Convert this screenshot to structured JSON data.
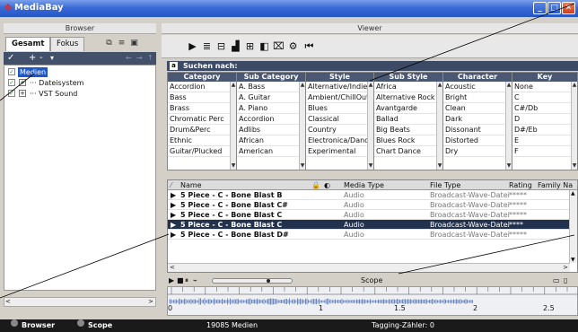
{
  "window": {
    "title": "MediaBay"
  },
  "browser": {
    "header": "Browser",
    "tabs": [
      "Gesamt",
      "Fokus"
    ],
    "toolbar": {
      "add": "+",
      "remove": "-",
      "menu": "▾",
      "back": "←",
      "forward": "→",
      "up": "↑"
    },
    "tree": [
      {
        "label": "Medien",
        "level": 0,
        "selected": true
      },
      {
        "label": "Dateisystem",
        "level": 1
      },
      {
        "label": "VST Sound",
        "level": 1
      }
    ]
  },
  "viewer": {
    "header": "Viewer",
    "search_label": "Suchen nach:",
    "filters": [
      {
        "header": "Category",
        "items": [
          "Accordion",
          "Bass",
          "Brass",
          "Chromatic Perc",
          "Drum&Perc",
          "Ethnic",
          "Guitar/Plucked"
        ]
      },
      {
        "header": "Sub Category",
        "items": [
          "A. Bass",
          "A. Guitar",
          "A. Piano",
          "Accordion",
          "Adlibs",
          "African",
          "American"
        ]
      },
      {
        "header": "Style",
        "items": [
          "Alternative/Indie",
          "Ambient/ChillOut",
          "Blues",
          "Classical",
          "Country",
          "Electronica/Danc",
          "Experimental"
        ]
      },
      {
        "header": "Sub Style",
        "items": [
          "Africa",
          "Alternative Rock",
          "Avantgarde",
          "Ballad",
          "Big Beats",
          "Blues Rock",
          "Chart Dance"
        ]
      },
      {
        "header": "Character",
        "items": [
          "Acoustic",
          "Bright",
          "Clean",
          "Dark",
          "Dissonant",
          "Distorted",
          "Dry"
        ]
      },
      {
        "header": "Key",
        "items": [
          "None",
          "C",
          "C#/Db",
          "D",
          "D#/Eb",
          "E",
          "F"
        ]
      }
    ],
    "results": {
      "columns": [
        "Name",
        "Media Type",
        "File Type",
        "Rating",
        "Family Na"
      ],
      "rows": [
        {
          "name": "5 Piece - C - Bone Blast B",
          "media_type": "Audio",
          "file_type": "Broadcast-Wave-Datei",
          "rating": "*****",
          "selected": false
        },
        {
          "name": "5 Piece - C - Bone Blast C#",
          "media_type": "Audio",
          "file_type": "Broadcast-Wave-Datei",
          "rating": "*****",
          "selected": false
        },
        {
          "name": "5 Piece - C - Bone Blast C",
          "media_type": "Audio",
          "file_type": "Broadcast-Wave-Datei",
          "rating": "*****",
          "selected": false
        },
        {
          "name": "5 Piece - C - Bone Blast C",
          "media_type": "Audio",
          "file_type": "Broadcast-Wave-Datei",
          "rating": "****",
          "selected": true
        },
        {
          "name": "5 Piece - C - Bone Blast D#",
          "media_type": "Audio",
          "file_type": "Broadcast-Wave-Datei",
          "rating": "*****",
          "selected": false
        }
      ]
    },
    "scope": {
      "label": "Scope",
      "ruler": [
        "0",
        "1",
        "1.5",
        "2",
        "2.5"
      ]
    }
  },
  "footer": {
    "browser_toggle": "Browser",
    "scope_toggle": "Scope",
    "count": "19085",
    "count_label": "Medien",
    "tagging": "Tagging-Zähler: 0"
  },
  "colors": {
    "titlebar": "#2456c4",
    "selection": "#22324e",
    "panel_dark": "#42506a"
  }
}
